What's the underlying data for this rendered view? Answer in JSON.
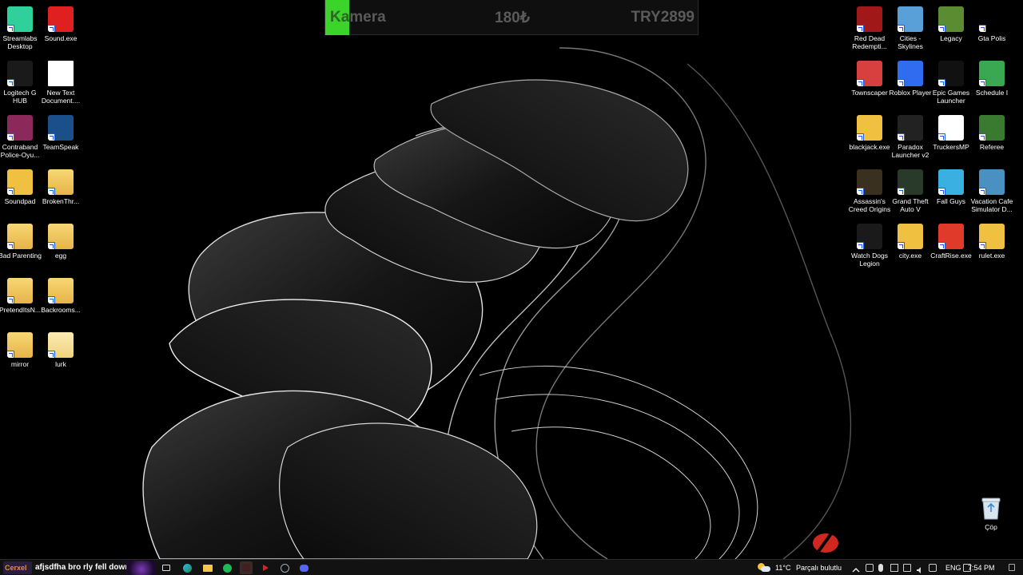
{
  "overlay": {
    "label": "Kamera",
    "price": "180₺",
    "total": "TRY2899",
    "progress_color": "#3bd42a"
  },
  "desktop_left": [
    {
      "label": "Streamlabs Desktop",
      "icon": "streamlabs-icon",
      "color": "#2fd09b"
    },
    {
      "label": "Sound.exe",
      "icon": "youtube-icon",
      "color": "#e02020"
    },
    {
      "label": "Logitech G HUB",
      "icon": "logitech-g-icon",
      "color": "#1a1a1a"
    },
    {
      "label": "New Text Document....",
      "icon": "text-document-icon",
      "color": "#ffffff"
    },
    {
      "label": "Contraband Police-Oyu...",
      "icon": "winrar-icon",
      "color": "#8b2a5a"
    },
    {
      "label": "TeamSpeak",
      "icon": "teamspeak-icon",
      "color": "#1b4f8a"
    },
    {
      "label": "Soundpad",
      "icon": "soundpad-icon",
      "color": "#f0c040"
    },
    {
      "label": "BrokenThr...",
      "icon": "folder-icon",
      "color": "#f0c040"
    },
    {
      "label": "Bad Parenting",
      "icon": "folder-icon",
      "color": "#f0c040"
    },
    {
      "label": "egg",
      "icon": "folder-icon",
      "color": "#f0c040"
    },
    {
      "label": "PretendItsN...",
      "icon": "folder-icon",
      "color": "#f0c040"
    },
    {
      "label": "Backrooms...",
      "icon": "folder-icon",
      "color": "#f0c040"
    },
    {
      "label": "mirror",
      "icon": "folder-icon",
      "color": "#f0c040"
    },
    {
      "label": "lurk",
      "icon": "folder-icon",
      "color": "#f5dc8a"
    }
  ],
  "desktop_right": [
    {
      "label": "Red Dead Redempti...",
      "icon": "red-dead-icon",
      "color": "#a01818"
    },
    {
      "label": "Cities - Skylines",
      "icon": "cities-skylines-icon",
      "color": "#5aa0d8"
    },
    {
      "label": "Legacy",
      "icon": "minecraft-icon",
      "color": "#5b8c32"
    },
    {
      "label": "Gta Polis",
      "icon": "rage-icon",
      "color": "#000000"
    },
    {
      "label": "Townscaper",
      "icon": "townscaper-icon",
      "color": "#d84040"
    },
    {
      "label": "Roblox Player",
      "icon": "roblox-icon",
      "color": "#2f6cf0"
    },
    {
      "label": "Epic Games Launcher",
      "icon": "epic-games-icon",
      "color": "#111111"
    },
    {
      "label": "Schedule I",
      "icon": "schedule-i-icon",
      "color": "#3aa850"
    },
    {
      "label": "blackjack.exe",
      "icon": "python-icon",
      "color": "#f0c040"
    },
    {
      "label": "Paradox Launcher v2",
      "icon": "paradox-icon",
      "color": "#222222"
    },
    {
      "label": "TruckersMP",
      "icon": "truckersmp-icon",
      "color": "#ffffff"
    },
    {
      "label": "Referee",
      "icon": "referee-icon",
      "color": "#3a7a30"
    },
    {
      "label": "Assassin's Creed Origins",
      "icon": "assassins-creed-icon",
      "color": "#3a3020"
    },
    {
      "label": "Grand Theft Auto V",
      "icon": "gta-v-icon",
      "color": "#2a3a2a"
    },
    {
      "label": "Fall Guys",
      "icon": "fall-guys-icon",
      "color": "#3ab0e0"
    },
    {
      "label": "Vacation Cafe Simulator D...",
      "icon": "vacation-cafe-icon",
      "color": "#4a90c0"
    },
    {
      "label": "Watch Dogs Legion",
      "icon": "watch-dogs-icon",
      "color": "#1a1a1a"
    },
    {
      "label": "city.exe",
      "icon": "python-icon",
      "color": "#f0c040"
    },
    {
      "label": "CraftRise.exe",
      "icon": "craftrise-icon",
      "color": "#e03a2a"
    },
    {
      "label": "rulet.exe",
      "icon": "python-icon",
      "color": "#f0c040"
    }
  ],
  "recycle_bin": {
    "label": "Çöp",
    "icon": "recycle-bin-icon"
  },
  "taskbar": {
    "start_text": "Cerxel",
    "marquee_text": "afjsdfha bro rly fell down",
    "weather_temp": "11°C",
    "weather_desc": "Parçalı bulutlu",
    "language": "ENG",
    "time": "7:54 PM"
  }
}
